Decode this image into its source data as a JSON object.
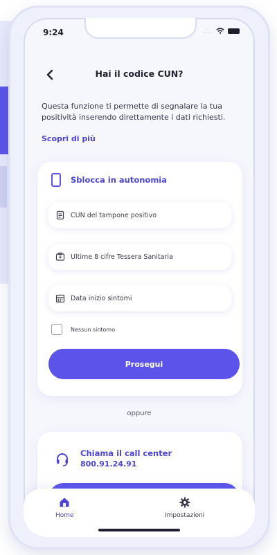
{
  "status": {
    "time": "9:24",
    "signal_dots": "...."
  },
  "header": {
    "title": "Hai il codice CUN?"
  },
  "intro": {
    "text": "Questa funzione ti permette di segnalare la tua positività inserendo direttamente i dati richiesti.",
    "more_link": "Scopri di più"
  },
  "unlock_card": {
    "title": "Sblocca in autonomia",
    "fields": [
      {
        "placeholder": "CUN del tampone positivo",
        "icon": "document-icon"
      },
      {
        "placeholder": "Ultime 8 cifre Tessera Sanitaria",
        "icon": "health-card-icon"
      },
      {
        "placeholder": "Data inizio sintomi",
        "icon": "calendar-icon"
      }
    ],
    "checkbox_label": "Nessun sintomo",
    "continue_label": "Prosegui"
  },
  "separator": "oppure",
  "call_card": {
    "title": "Chiama il call center",
    "number": "800.91.24.91"
  },
  "tabbar": {
    "home_label": "Home",
    "settings_label": "Impostazioni"
  },
  "colors": {
    "accent": "#5b53ea",
    "accent_text": "#4b44d6",
    "background": "#f6f7fd"
  }
}
